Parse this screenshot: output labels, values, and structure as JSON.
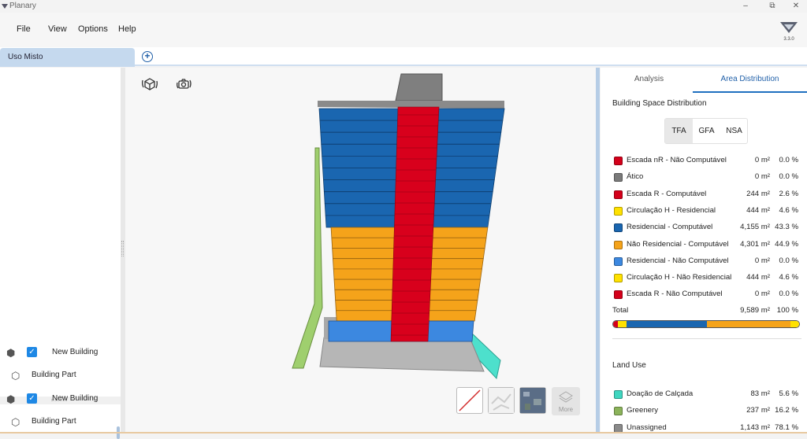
{
  "app": {
    "title": "Planary",
    "version": "3.3.0"
  },
  "window_controls": {
    "minimize": "–",
    "restore": "⧉",
    "close": "✕"
  },
  "menu": {
    "file": "File",
    "view": "View",
    "options": "Options",
    "help": "Help"
  },
  "tabs": {
    "active": "Uso Misto",
    "add_icon": "+"
  },
  "tree": {
    "items": [
      {
        "label": "New Building",
        "checked": true
      },
      {
        "label": "Building Part"
      },
      {
        "label": "New Building",
        "checked": true
      },
      {
        "label": "Building Part"
      }
    ]
  },
  "viewport": {
    "view_buttons": [
      "no-map-icon",
      "map-view-icon",
      "satellite-view-icon"
    ],
    "more_label": "More"
  },
  "right_panel": {
    "tabs": [
      "Analysis",
      "Area Distribution"
    ],
    "active_tab": "Area Distribution",
    "space_title": "Building Space Distribution",
    "area_modes": [
      "TFA",
      "GFA",
      "NSA"
    ],
    "selected_mode": "TFA",
    "space_rows": [
      {
        "name": "Escada nR - Não Computável",
        "area": "0 m²",
        "pct": "0.0 %",
        "color": "#d4001a"
      },
      {
        "name": "Ático",
        "area": "0 m²",
        "pct": "0.0 %",
        "color": "#7a7a7a"
      },
      {
        "name": "Escada R - Computável",
        "area": "244 m²",
        "pct": "2.6 %",
        "color": "#d4001a"
      },
      {
        "name": "Circulação H - Residencial",
        "area": "444 m²",
        "pct": "4.6 %",
        "color": "#ffe100"
      },
      {
        "name": "Residencial - Computável",
        "area": "4,155 m²",
        "pct": "43.3 %",
        "color": "#1a66b0"
      },
      {
        "name": "Não Residencial - Computável",
        "area": "4,301 m²",
        "pct": "44.9 %",
        "color": "#f5a31a"
      },
      {
        "name": "Residencial - Não Computável",
        "area": "0 m²",
        "pct": "0.0 %",
        "color": "#3c88e0"
      },
      {
        "name": "Circulação H - Não Residencial",
        "area": "444 m²",
        "pct": "4.6 %",
        "color": "#ffe100"
      },
      {
        "name": "Escada R - Não Computável",
        "area": "0 m²",
        "pct": "0.0 %",
        "color": "#d4001a"
      }
    ],
    "total": {
      "label": "Total",
      "area": "9,589 m²",
      "pct": "100 %"
    },
    "distribution_bar": [
      {
        "pct": 2.6,
        "color": "#d4001a"
      },
      {
        "pct": 4.6,
        "color": "#ffe100"
      },
      {
        "pct": 43.3,
        "color": "#1a66b0"
      },
      {
        "pct": 44.9,
        "color": "#f5a31a"
      },
      {
        "pct": 4.6,
        "color": "#ffe100"
      }
    ],
    "land_title": "Land Use",
    "land_rows": [
      {
        "name": "Doação de Calçada",
        "area": "83 m²",
        "pct": "5.6 %",
        "color": "#3fd6c0"
      },
      {
        "name": "Greenery",
        "area": "237 m²",
        "pct": "16.2 %",
        "color": "#8bb35a"
      },
      {
        "name": "Unassigned",
        "area": "1,143 m²",
        "pct": "78.1 %",
        "color": "#8a8a8a"
      }
    ]
  }
}
